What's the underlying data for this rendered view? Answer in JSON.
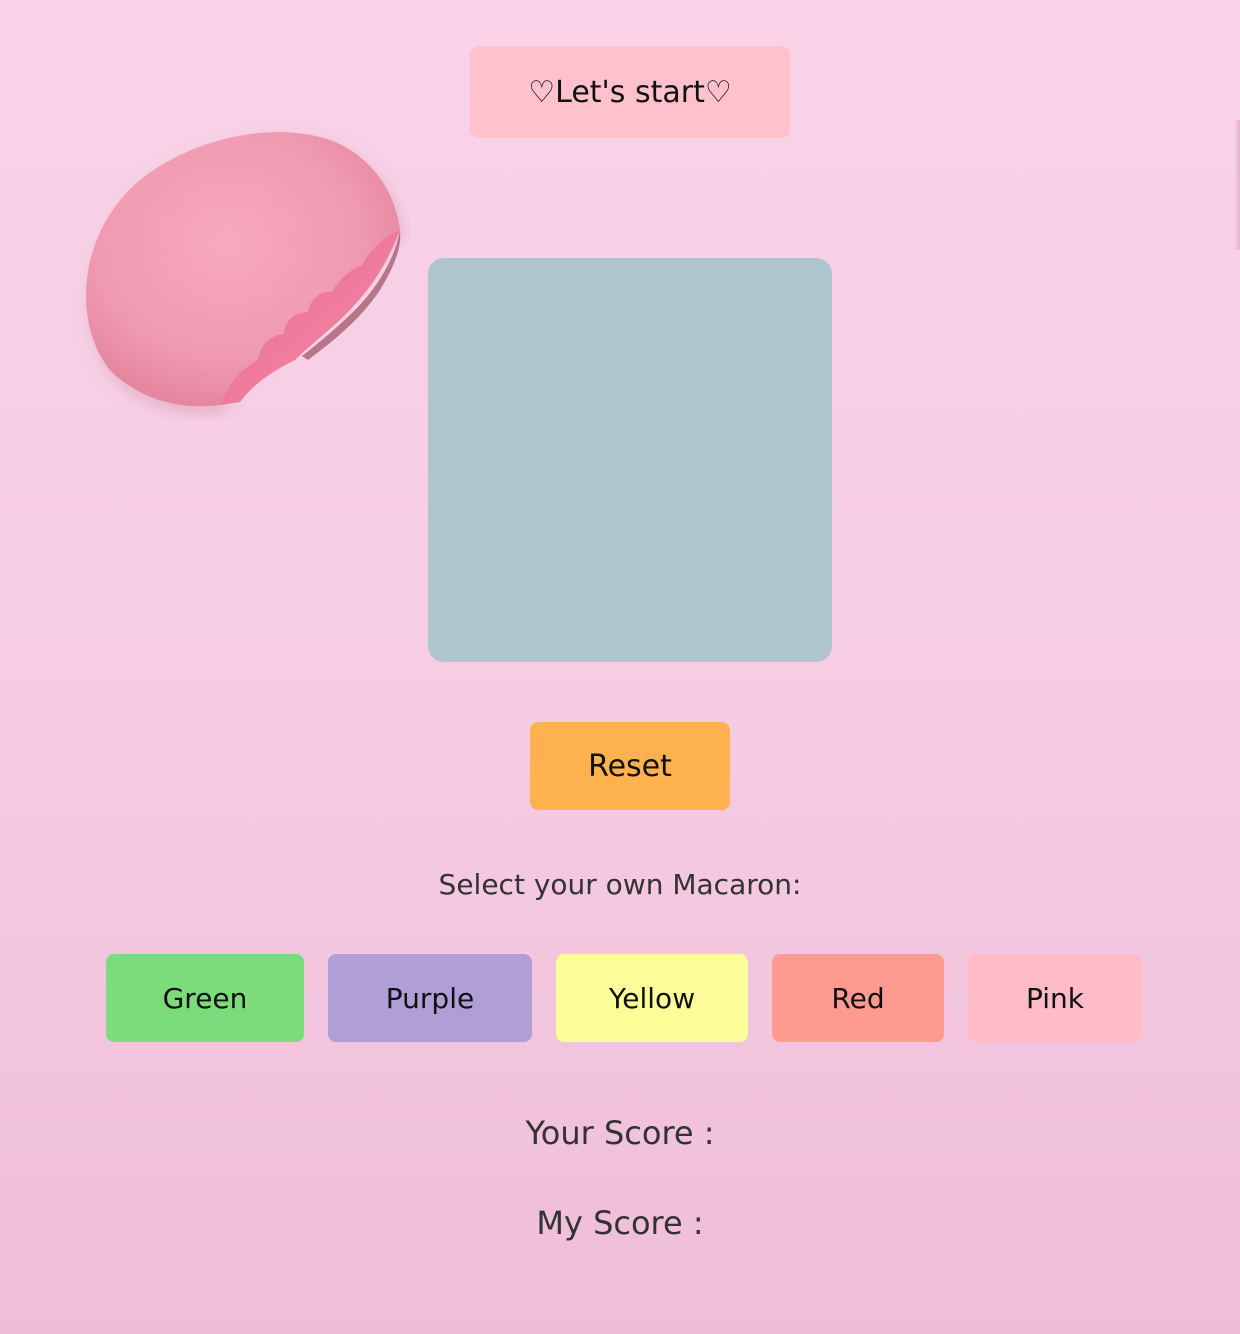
{
  "header": {
    "start_label": "♡Let's start♡"
  },
  "game": {
    "square_color": "#aec5cd",
    "reset_label": "Reset"
  },
  "selection": {
    "prompt": "Select your own Macaron:",
    "choices": [
      {
        "label": "Green",
        "color": "#7cdb7b"
      },
      {
        "label": "Purple",
        "color": "#b09fd6"
      },
      {
        "label": "Yellow",
        "color": "#fcfc99"
      },
      {
        "label": "Red",
        "color": "#fe9a8f"
      },
      {
        "label": "Pink",
        "color": "#ffbcc8"
      }
    ]
  },
  "scores": {
    "your_score_label": "Your Score :",
    "my_score_label": "My Score :"
  },
  "decor": {
    "macaron_image": "pink-macaron-bitten-image",
    "background_color": "#f6cde3"
  }
}
